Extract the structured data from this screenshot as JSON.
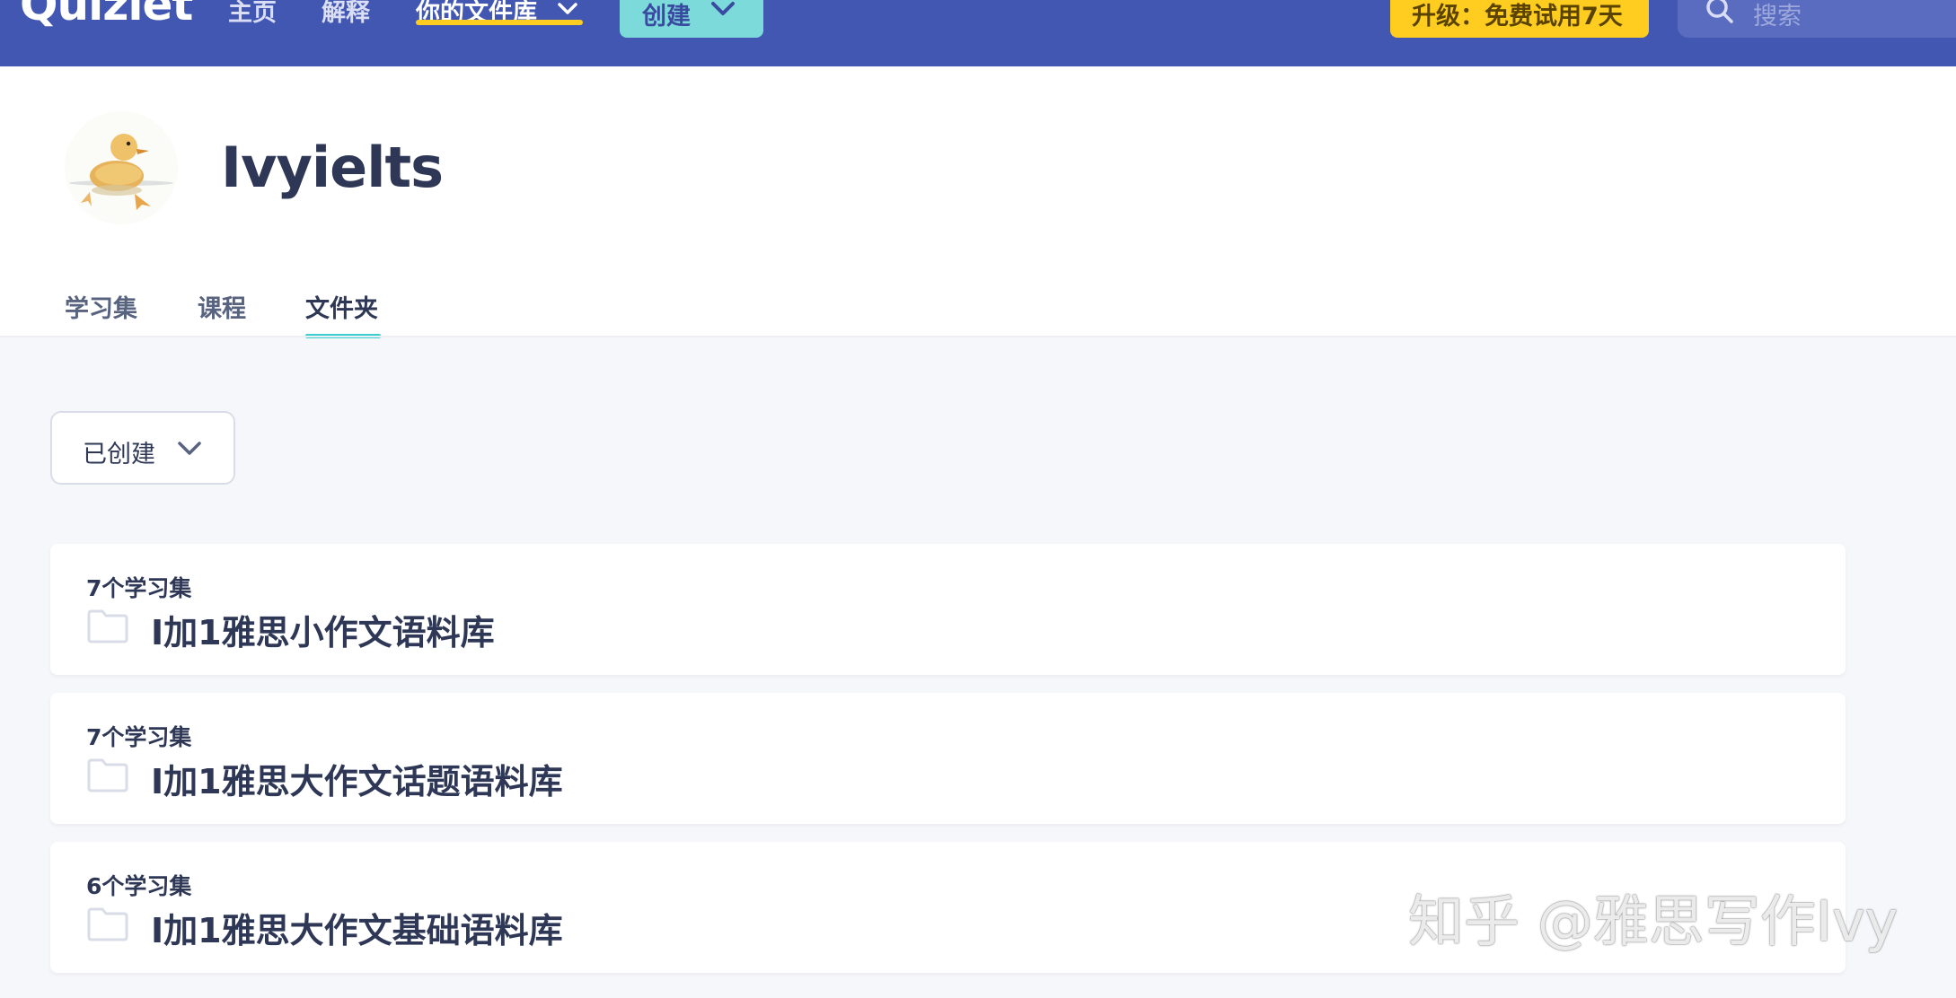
{
  "nav": {
    "logo": "Quizlet",
    "home": "主页",
    "explain": "解释",
    "library": "你的文件库",
    "create": "创建",
    "upgrade": "升级：免费试用7天",
    "search_placeholder": "搜索"
  },
  "profile": {
    "username": "Ivyielts",
    "tabs": [
      "学习集",
      "课程",
      "文件夹"
    ],
    "active_tab": "文件夹"
  },
  "filter": {
    "selected": "已创建"
  },
  "folders": [
    {
      "count": "7个学习集",
      "name": "I加1雅思小作文语料库"
    },
    {
      "count": "7个学习集",
      "name": "I加1雅思大作文话题语料库"
    },
    {
      "count": "6个学习集",
      "name": "I加1雅思大作文基础语料库"
    }
  ],
  "watermark": "知乎 @雅思写作Ivy",
  "colors": {
    "nav_bg": "#4257b2",
    "create_btn": "#7ddadb",
    "upgrade_btn": "#ffcd1f",
    "tab_underline": "#3ccfcf",
    "page_bg": "#f6f7fb"
  }
}
